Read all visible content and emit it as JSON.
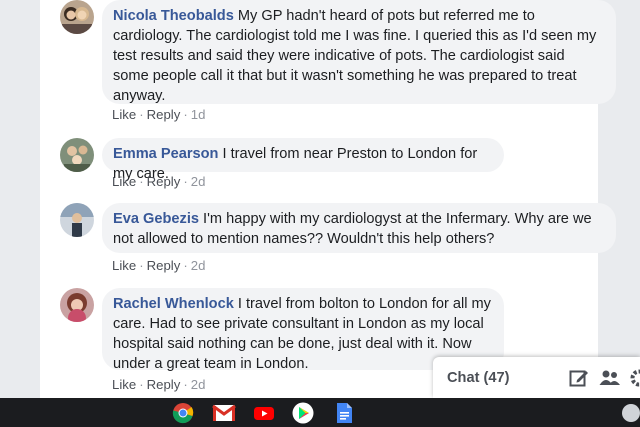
{
  "comments": [
    {
      "author": "Nicola Theobalds",
      "text": " My GP hadn't heard of pots but referred me to cardiology. The cardiologist told me I was fine. I queried this as I'd seen my test results and said they were indicative of pots. The cardiologist said some people call it that but it wasn't something he was prepared to treat anyway.",
      "like": "Like",
      "reply": "Reply",
      "time": "1d"
    },
    {
      "author": "Emma Pearson",
      "text": " I travel from near Preston to London for my care.",
      "like": "Like",
      "reply": "Reply",
      "time": "2d"
    },
    {
      "author": "Eva Gebezis",
      "text": " I'm happy with my cardiologyst at the Infermary. Why are we not allowed to mention names?? Wouldn't this help others?",
      "like": "Like",
      "reply": "Reply",
      "time": "2d"
    },
    {
      "author": "Rachel Whenlock",
      "text": " I travel from bolton to London for all my care. Had to see private consultant in London as my local hospital said nothing can be done, just deal with it. Now under a great team in London.",
      "like": "Like",
      "reply": "Reply",
      "time": "2d"
    }
  ],
  "chat": {
    "label": "Chat (47)"
  },
  "icons": {
    "chat_compose": "compose-icon",
    "chat_contacts": "contacts-icon",
    "chat_settings": "gear-icon",
    "taskbar": [
      "chrome-icon",
      "gmail-icon",
      "youtube-icon",
      "play-store-icon",
      "docs-icon"
    ]
  },
  "colors": {
    "author": "#385898",
    "bubble": "#f2f3f5",
    "page_bg": "#e9ebee",
    "taskbar": "#1b1c1f"
  }
}
